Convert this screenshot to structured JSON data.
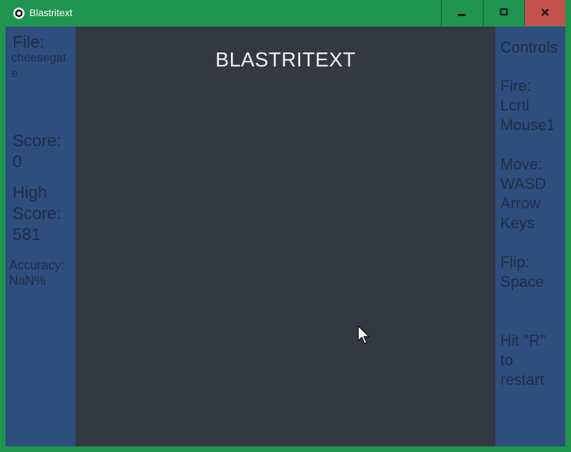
{
  "window": {
    "title": "Blastritext",
    "controls": [
      "minimize",
      "maximize",
      "close"
    ]
  },
  "left_panel": {
    "file_label": "File:",
    "file_name": "cheesegate",
    "score_label": "Score:",
    "score_value": "0",
    "high_score_label": "High\nScore:",
    "high_score_value": "581",
    "accuracy_label": "Accuracy:",
    "accuracy_value": "NaN%"
  },
  "game": {
    "title": "BLASTRITEXT"
  },
  "right_panel": {
    "controls_heading": "Controls",
    "fire": "Fire:\nLcrtl\nMouse1",
    "move": "Move:\nWASD\nArrow\nKeys",
    "flip": "Flip:\nSpace",
    "restart": "Hit \"R\"\nto\nrestart"
  },
  "colors": {
    "frame": "#1f9550",
    "close_button": "#c4504c",
    "side_panel": "#2e4e7e",
    "game_area": "#343841",
    "panel_text": "#1f2f48",
    "title_text": "#eef0f2"
  },
  "icons": [
    "app-icon",
    "minimize-icon",
    "maximize-icon",
    "close-icon",
    "mouse-cursor-icon"
  ]
}
